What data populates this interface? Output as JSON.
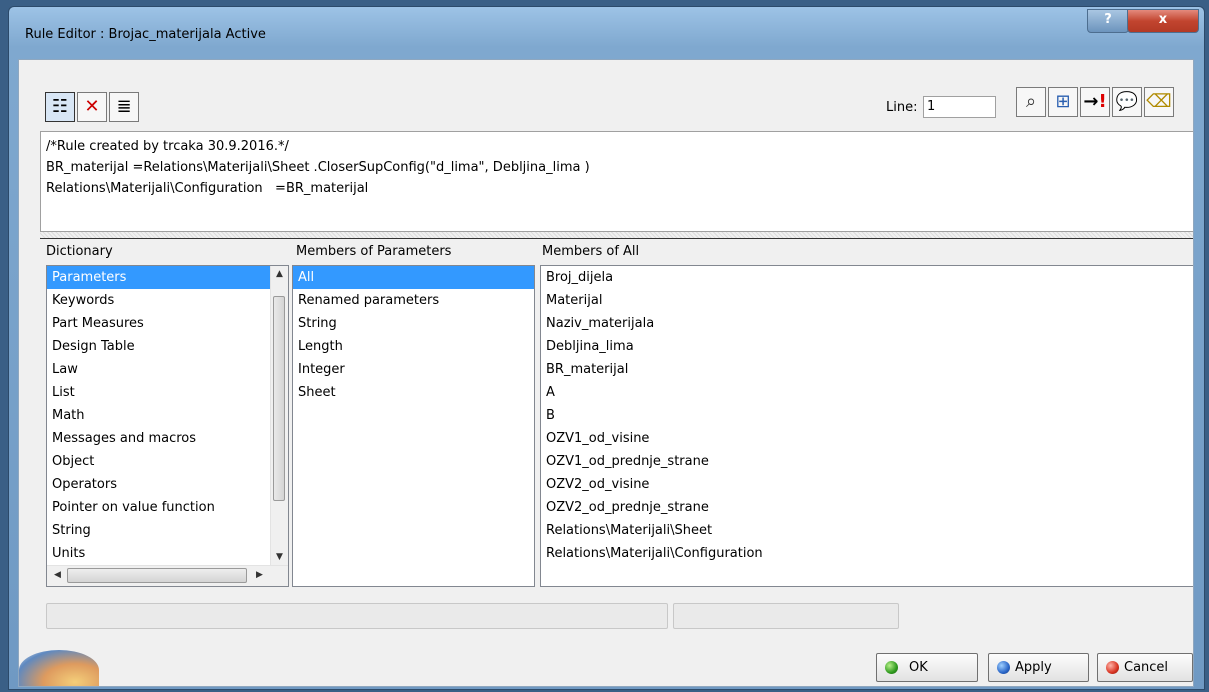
{
  "window": {
    "title": "Rule Editor : Brojac_materijala Active",
    "help_label": "?",
    "close_label": "x"
  },
  "toolbar": {
    "left_icons": [
      "tree-icon",
      "clear-icon",
      "list-icon"
    ],
    "line_label": "Line:",
    "line_value": "1",
    "right_icons": [
      "find-icon",
      "browse-icon",
      "go-to-error-icon",
      "comment-icon",
      "eraser-icon"
    ]
  },
  "editor": {
    "lines": [
      "/*Rule created by trcaka 30.9.2016.*/",
      "BR_materijal =Relations\\Materijali\\Sheet .CloserSupConfig(\"d_lima\", Debljina_lima )",
      "Relations\\Materijali\\Configuration   =BR_materijal"
    ]
  },
  "dictionary": {
    "header": "Dictionary",
    "items": [
      "Parameters",
      "Keywords",
      "Part Measures",
      "Design Table",
      "Law",
      "List",
      "Math",
      "Messages and macros",
      "Object",
      "Operators",
      "Pointer on value function",
      "String",
      "Units"
    ],
    "selected": "Parameters"
  },
  "members_params": {
    "header": "Members of Parameters",
    "items": [
      "All",
      "Renamed parameters",
      "String",
      "Length",
      "Integer",
      "Sheet"
    ],
    "selected": "All"
  },
  "members_all": {
    "header": "Members of All",
    "items": [
      "Broj_dijela",
      "Materijal",
      "Naziv_materijala",
      "Debljina_lima",
      "BR_materijal",
      "A",
      "B",
      "OZV1_od_visine",
      "OZV1_od_prednje_strane",
      "OZV2_od_visine",
      "OZV2_od_prednje_strane",
      "Relations\\Materijali\\Sheet",
      "Relations\\Materijali\\Configuration"
    ]
  },
  "buttons": {
    "ok": "OK",
    "apply": "Apply",
    "cancel": "Cancel"
  }
}
